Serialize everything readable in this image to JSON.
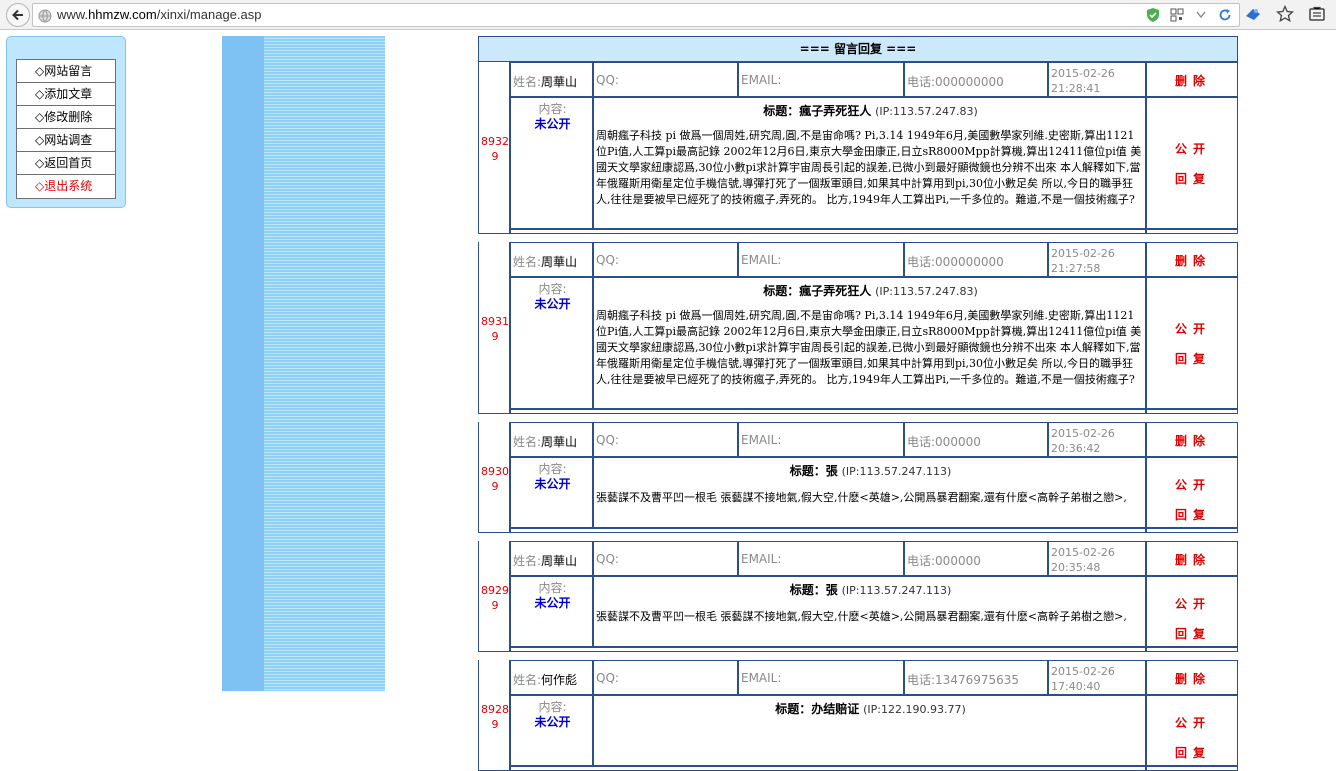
{
  "browser": {
    "url_prefix": "www.",
    "url_domain": "hhmzw.com",
    "url_path": "/xinxi/manage.asp"
  },
  "menu": {
    "items": [
      {
        "label": "◇网站留言"
      },
      {
        "label": "◇添加文章"
      },
      {
        "label": "◇修改删除"
      },
      {
        "label": "◇网站调查"
      },
      {
        "label": "◇返回首页"
      },
      {
        "label": "◇退出系统"
      }
    ]
  },
  "header": {
    "title": "=== 留言回复 ==="
  },
  "labels": {
    "name": "姓名:",
    "qq": "QQ:",
    "email": "EMAIL:",
    "tel": "电话:",
    "content": "内容:",
    "title_prefix": "标题：",
    "delete": "删除",
    "publish": "公开",
    "reply": "回复"
  },
  "messages": [
    {
      "id_a": "8932",
      "id_b": "9",
      "name": "周華山",
      "qq": "",
      "email": "",
      "tel": "000000000",
      "date": "2015-02-26",
      "time": "21:28:41",
      "status": "未公开",
      "title": "瘋子弄死狂人",
      "ip": "(IP:113.57.247.83)",
      "body": "周朝瘋子科技 pi 做爲一個周姓,研究周,圓,不是宙命嗎? Pi,3.14 1949年6月,美國數學家列維.史密斯,算出1121位Pi值,人工算pi最高記錄 2002年12月6日,東京大學金田康正,日立sR8000Mpp計算機,算出12411億位pi值 美國天文學家紐康認爲,30位小數pi求計算宇宙周長引起的誤差,已微小到最好顯微鏡也分辨不出來 本人解釋如下,當年俄羅斯用衛星定位手機信號,導彈打死了一個叛軍頭目,如果其中計算用到pi,30位小數足矣 所以,今日的職爭狂人,往往是要被早已經死了的技術瘋子,弄死的。 比方,1949年人工算出Pi,一千多位的。難道,不是一個技術瘋子?"
    },
    {
      "id_a": "8931",
      "id_b": "9",
      "name": "周華山",
      "qq": "",
      "email": "",
      "tel": "000000000",
      "date": "2015-02-26",
      "time": "21:27:58",
      "status": "未公开",
      "title": "瘋子弄死狂人",
      "ip": "(IP:113.57.247.83)",
      "body": "周朝瘋子科技 pi 做爲一個周姓,研究周,圓,不是宙命嗎? Pi,3.14 1949年6月,美國數學家列維.史密斯,算出1121位Pi值,人工算pi最高記錄 2002年12月6日,東京大學金田康正,日立sR8000Mpp計算機,算出12411億位pi值 美國天文學家紐康認爲,30位小數pi求計算宇宙周長引起的誤差,已微小到最好顯微鏡也分辨不出來 本人解釋如下,當年俄羅斯用衛星定位手機信號,導彈打死了一個叛軍頭目,如果其中計算用到pi,30位小數足矣 所以,今日的職爭狂人,往往是要被早已經死了的技術瘋子,弄死的。 比方,1949年人工算出Pi,一千多位的。難道,不是一個技術瘋子?"
    },
    {
      "id_a": "8930",
      "id_b": "9",
      "name": "周華山",
      "qq": "",
      "email": "",
      "tel": "000000",
      "date": "2015-02-26",
      "time": "20:36:42",
      "status": "未公开",
      "title": "張",
      "ip": "(IP:113.57.247.113)",
      "body": "張藝謀不及曹平凹一根毛 張藝謀不接地氣,假大空,什麽<英雄>,公開爲暴君翻案,還有什麽<高幹子弟樹之戀>,"
    },
    {
      "id_a": "8929",
      "id_b": "9",
      "name": "周華山",
      "qq": "",
      "email": "",
      "tel": "000000",
      "date": "2015-02-26",
      "time": "20:35:48",
      "status": "未公开",
      "title": "張",
      "ip": "(IP:113.57.247.113)",
      "body": "張藝謀不及曹平凹一根毛 張藝謀不接地氣,假大空,什麽<英雄>,公開爲暴君翻案,還有什麽<高幹子弟樹之戀>,"
    },
    {
      "id_a": "8928",
      "id_b": "9",
      "name": "何作彪",
      "qq": "",
      "email": "",
      "tel": "13476975635",
      "date": "2015-02-26",
      "time": "17:40:40",
      "status": "未公开",
      "title": "办结赔证",
      "ip": "(IP:122.190.93.77)",
      "body": ""
    }
  ]
}
